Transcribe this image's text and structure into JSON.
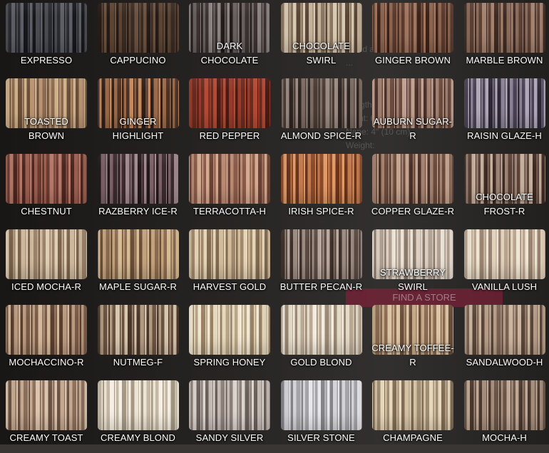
{
  "swatches": [
    {
      "name": "EXPRESSO",
      "lines": [
        "EXPRESSO"
      ],
      "colors": [
        "#2a2b30",
        "#4a4c52",
        "#16171b",
        "#5d5f66"
      ]
    },
    {
      "name": "CAPPUCINO",
      "lines": [
        "CAPPUCINO"
      ],
      "colors": [
        "#3a2b22",
        "#5c4434",
        "#251a14",
        "#6b5240"
      ]
    },
    {
      "name": "DARK CHOCOLATE",
      "lines": [
        "DARK",
        "CHOCOLATE"
      ],
      "colors": [
        "#3b3130",
        "#67605e",
        "#231c1b",
        "#8a8382"
      ]
    },
    {
      "name": "CHOCOLATE SWIRL",
      "lines": [
        "CHOCOLATE",
        "SWIRL"
      ],
      "colors": [
        "#8a7560",
        "#c4b29a",
        "#5a4636",
        "#d8c9b2"
      ]
    },
    {
      "name": "GINGER BROWN",
      "lines": [
        "GINGER BROWN"
      ],
      "colors": [
        "#5a3a2c",
        "#8a6450",
        "#3a2219",
        "#a07660"
      ]
    },
    {
      "name": "MARBLE BROWN",
      "lines": [
        "MARBLE BROWN"
      ],
      "colors": [
        "#5c4034",
        "#8b6b5a",
        "#3e2a22",
        "#a48270"
      ]
    },
    {
      "name": "TOASTED BROWN",
      "lines": [
        "TOASTED",
        "BROWN"
      ],
      "colors": [
        "#8a6a4e",
        "#b89472",
        "#6a4e38",
        "#cfb08a"
      ]
    },
    {
      "name": "GINGER HIGHLIGHT",
      "lines": [
        "GINGER",
        "HIGHLIGHT"
      ],
      "colors": [
        "#4a3228",
        "#9a6a4a",
        "#2e1e18",
        "#c48a5e"
      ]
    },
    {
      "name": "RED PEPPER",
      "lines": [
        "RED PEPPER"
      ],
      "colors": [
        "#6a2a1e",
        "#9a3a28",
        "#4a1a12",
        "#b44a34"
      ]
    },
    {
      "name": "ALMOND SPICE-R",
      "lines": [
        "ALMOND SPICE-R"
      ],
      "colors": [
        "#4a3a34",
        "#7a6a62",
        "#2e2420",
        "#9a8a82"
      ]
    },
    {
      "name": "AUBURN SUGAR-R",
      "lines": [
        "AUBURN SUGAR-",
        "R"
      ],
      "colors": [
        "#6a4a3c",
        "#a08070",
        "#4a3028",
        "#c0a090"
      ]
    },
    {
      "name": "RAISIN GLAZE-H",
      "lines": [
        "RAISIN GLAZE-H"
      ],
      "colors": [
        "#4a4254",
        "#8a8294",
        "#2e2836",
        "#b0a8b8"
      ]
    },
    {
      "name": "CHESTNUT",
      "lines": [
        "CHESTNUT"
      ],
      "colors": [
        "#6a3a30",
        "#9a5e50",
        "#4a2620",
        "#b47868"
      ]
    },
    {
      "name": "RAZBERRY ICE-R",
      "lines": [
        "RAZBERRY ICE-R"
      ],
      "colors": [
        "#3a2a2e",
        "#7a6268",
        "#22181a",
        "#a08a90"
      ]
    },
    {
      "name": "TERRACOTTA-H",
      "lines": [
        "TERRACOTTA-H"
      ],
      "colors": [
        "#8a5a48",
        "#b88a72",
        "#6a4234",
        "#d4aa90"
      ]
    },
    {
      "name": "IRISH SPICE-R",
      "lines": [
        "IRISH SPICE-R"
      ],
      "colors": [
        "#8a4a2a",
        "#c27a4e",
        "#6a341c",
        "#e09a68"
      ]
    },
    {
      "name": "COPPER GLAZE-R",
      "lines": [
        "COPPER GLAZE-R"
      ],
      "colors": [
        "#6a4a3a",
        "#a48270",
        "#4a3026",
        "#c4a48e"
      ]
    },
    {
      "name": "CHOCOLATE FROST-R",
      "lines": [
        "CHOCOLATE",
        "FROST-R"
      ],
      "colors": [
        "#5a4238",
        "#9a8274",
        "#3e2a22",
        "#c4ae9e"
      ]
    },
    {
      "name": "ICED MOCHA-R",
      "lines": [
        "ICED MOCHA-R"
      ],
      "colors": [
        "#9a826a",
        "#cdb89c",
        "#7a624c",
        "#e0ceb4"
      ]
    },
    {
      "name": "MAPLE SUGAR-R",
      "lines": [
        "MAPLE SUGAR-R"
      ],
      "colors": [
        "#8a6a4e",
        "#c2a27e",
        "#6a4e36",
        "#d8bc96"
      ]
    },
    {
      "name": "HARVEST GOLD",
      "lines": [
        "HARVEST GOLD"
      ],
      "colors": [
        "#a0886c",
        "#d2bc9c",
        "#806a50",
        "#e6d4b6"
      ]
    },
    {
      "name": "BUTTER PECAN-R",
      "lines": [
        "BUTTER PECAN-R"
      ],
      "colors": [
        "#5a4a42",
        "#9a8a80",
        "#3e302a",
        "#b8a89e"
      ]
    },
    {
      "name": "STRAWBERRY SWIRL",
      "lines": [
        "STRAWBERRY",
        "SWIRL"
      ],
      "colors": [
        "#b0a092",
        "#ddd0c2",
        "#8a7a6c",
        "#ece2d6"
      ]
    },
    {
      "name": "VANILLA LUSH",
      "lines": [
        "VANILLA LUSH"
      ],
      "colors": [
        "#b8a48e",
        "#e2d2bc",
        "#988470",
        "#f0e4d2"
      ]
    },
    {
      "name": "MOCHACCINO-R",
      "lines": [
        "MOCHACCINO-R"
      ],
      "colors": [
        "#7a5a46",
        "#b89a80",
        "#5a3e2e",
        "#d4b89c"
      ]
    },
    {
      "name": "NUTMEG-F",
      "lines": [
        "NUTMEG-F"
      ],
      "colors": [
        "#6a5240",
        "#b09a80",
        "#4a3628",
        "#d8c6ae"
      ]
    },
    {
      "name": "SPRING HONEY",
      "lines": [
        "SPRING HONEY"
      ],
      "colors": [
        "#b8a486",
        "#e6d8bc",
        "#988266",
        "#f2e8d2"
      ]
    },
    {
      "name": "GOLD BLOND",
      "lines": [
        "GOLD BLOND"
      ],
      "colors": [
        "#b8a894",
        "#e4dac8",
        "#988874",
        "#f4ece0"
      ]
    },
    {
      "name": "CREAMY TOFFEE-R",
      "lines": [
        "CREAMY TOFFEE-",
        "R"
      ],
      "colors": [
        "#8a6a50",
        "#c4a888",
        "#6a4e3a",
        "#dcc4a4"
      ]
    },
    {
      "name": "SANDALWOOD-H",
      "lines": [
        "SANDALWOOD-H"
      ],
      "colors": [
        "#7a6252",
        "#b49c88",
        "#5a4638",
        "#ccb6a2"
      ]
    },
    {
      "name": "CREAMY TOAST",
      "lines": [
        "CREAMY TOAST"
      ],
      "colors": [
        "#8a6e5a",
        "#c4a890",
        "#6a5242",
        "#dcc4ae"
      ]
    },
    {
      "name": "CREAMY BLOND",
      "lines": [
        "CREAMY BLOND"
      ],
      "colors": [
        "#c4b8a4",
        "#ece4d4",
        "#a49884",
        "#f6f0e4"
      ]
    },
    {
      "name": "SANDY SILVER",
      "lines": [
        "SANDY SILVER"
      ],
      "colors": [
        "#8a7e78",
        "#c4bab4",
        "#6a605a",
        "#dcd4ce"
      ]
    },
    {
      "name": "SILVER STONE",
      "lines": [
        "SILVER STONE"
      ],
      "colors": [
        "#a4a4a8",
        "#d4d4d8",
        "#848488",
        "#e8e8ec"
      ]
    },
    {
      "name": "CHAMPAGNE",
      "lines": [
        "CHAMPAGNE"
      ],
      "colors": [
        "#a08c72",
        "#d4c2a4",
        "#806c54",
        "#e8d8bc"
      ]
    },
    {
      "name": "MOCHA-H",
      "lines": [
        "MOCHA-H"
      ],
      "colors": [
        "#6a5446",
        "#a48c7a",
        "#4a382e",
        "#c0a896"
      ]
    }
  ],
  "background_text": {
    "lines": [
      "...and a s...",
      "",
      "...",
      "Length:",
      "Front: 6\" (15 cm)",
      "Nape: 4\" (10 cm)",
      "Weight:"
    ],
    "button": "FIND A STORE"
  }
}
